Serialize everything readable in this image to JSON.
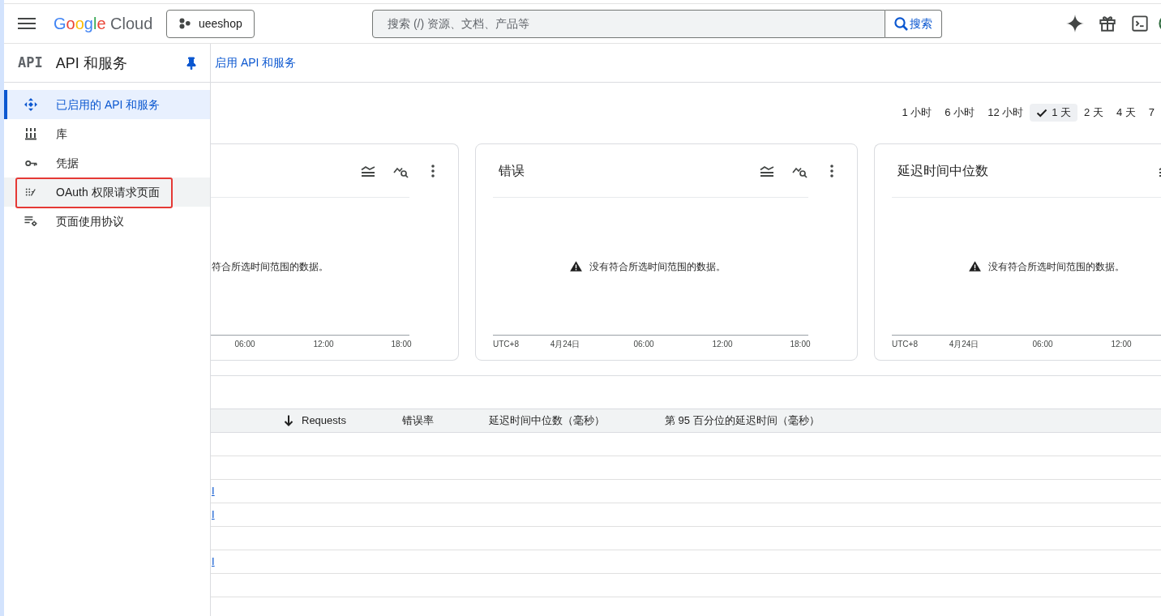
{
  "top_bar": {
    "logo": {
      "brand": "Google",
      "product": "Cloud"
    },
    "project": "ueeshop",
    "search": {
      "placeholder": "搜索 (/) 资源、文档、产品等",
      "button": "搜索"
    }
  },
  "sidebar": {
    "logo": "API",
    "title": "API 和服务",
    "pinned": true,
    "items": [
      {
        "label": "已启用的 API 和服务",
        "selected": true,
        "hovered": false,
        "annotated": false
      },
      {
        "label": "库",
        "selected": false,
        "hovered": false,
        "annotated": false
      },
      {
        "label": "凭据",
        "selected": false,
        "hovered": false,
        "annotated": false
      },
      {
        "label": "OAuth 权限请求页面",
        "selected": false,
        "hovered": true,
        "annotated": true
      },
      {
        "label": "页面使用协议",
        "selected": false,
        "hovered": false,
        "annotated": false
      }
    ]
  },
  "page": {
    "action": "启用 API 和服务"
  },
  "time_ranges": [
    {
      "label": "1 小时",
      "selected": false
    },
    {
      "label": "6 小时",
      "selected": false
    },
    {
      "label": "12 小时",
      "selected": false
    },
    {
      "label": "1 天",
      "selected": true
    },
    {
      "label": "2 天",
      "selected": false
    },
    {
      "label": "4 天",
      "selected": false
    },
    {
      "label": "7",
      "selected": false
    }
  ],
  "charts": [
    {
      "kind": "clipped_left",
      "message": "符合所选时间范围的数据。",
      "x_labels": [
        "06:00",
        "12:00",
        "18:00"
      ]
    },
    {
      "kind": "full",
      "title": "错误",
      "message": "没有符合所选时间范围的数据。",
      "x_labels": [
        "UTC+8",
        "4月24日",
        "06:00",
        "12:00",
        "18:00"
      ]
    },
    {
      "kind": "clipped_right",
      "title": "延迟时间中位数",
      "message": "没有符合所选时间范围的数据。",
      "x_labels": [
        "UTC+8",
        "4月24日",
        "06:00",
        "12:00"
      ]
    }
  ],
  "table": {
    "columns": [
      {
        "label": "Requests",
        "sorted": true
      },
      {
        "label": "错误率",
        "sorted": false
      },
      {
        "label": "延迟时间中位数（毫秒）",
        "sorted": false
      },
      {
        "label": "第 95 百分位的延迟时间（毫秒）",
        "sorted": false
      }
    ],
    "rows": [
      {},
      {},
      {
        "column_1": "I"
      },
      {
        "column_1": "I"
      },
      {},
      {
        "column_1": "I"
      },
      {},
      {}
    ]
  }
}
